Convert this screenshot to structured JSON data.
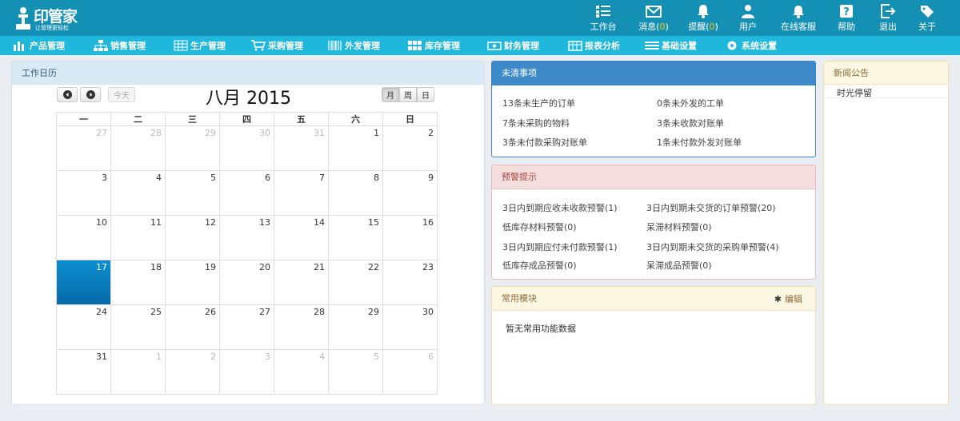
{
  "brand": {
    "name": "印管家",
    "slogan": "让管理更轻松"
  },
  "top_nav": [
    {
      "label": "工作台",
      "icon": "workbench-icon"
    },
    {
      "label": "消息",
      "count": "0",
      "icon": "envelope-icon"
    },
    {
      "label": "提醒",
      "count": "0",
      "icon": "bell-icon"
    },
    {
      "label": "用户",
      "icon": "user-icon"
    },
    {
      "label": "在线客服",
      "icon": "service-bell-icon"
    },
    {
      "label": "帮助",
      "icon": "help-icon"
    },
    {
      "label": "退出",
      "icon": "logout-icon"
    },
    {
      "label": "关于",
      "icon": "tag-icon"
    }
  ],
  "menu": [
    {
      "label": "产品管理",
      "icon": "bar-chart-icon"
    },
    {
      "label": "销售管理",
      "icon": "sitemap-icon"
    },
    {
      "label": "生产管理",
      "icon": "grid-icon"
    },
    {
      "label": "采购管理",
      "icon": "cart-icon"
    },
    {
      "label": "外发管理",
      "icon": "barcode-icon"
    },
    {
      "label": "库存管理",
      "icon": "blocks-icon"
    },
    {
      "label": "财务管理",
      "icon": "money-icon"
    },
    {
      "label": "报表分析",
      "icon": "calendar-table-icon"
    },
    {
      "label": "基础设置",
      "icon": "list-icon"
    },
    {
      "label": "系统设置",
      "icon": "gear-icon"
    }
  ],
  "calendar": {
    "panel_title": "工作日历",
    "title": "八月 2015",
    "today_label": "今天",
    "views": [
      "月",
      "周",
      "日"
    ],
    "active_view": "月",
    "weekdays": [
      "一",
      "二",
      "三",
      "四",
      "五",
      "六",
      "日"
    ],
    "today": "17",
    "weeks": [
      [
        {
          "d": "27",
          "o": 1
        },
        {
          "d": "28",
          "o": 1
        },
        {
          "d": "29",
          "o": 1
        },
        {
          "d": "30",
          "o": 1
        },
        {
          "d": "31",
          "o": 1
        },
        {
          "d": "1"
        },
        {
          "d": "2"
        }
      ],
      [
        {
          "d": "3"
        },
        {
          "d": "4"
        },
        {
          "d": "5"
        },
        {
          "d": "6"
        },
        {
          "d": "7"
        },
        {
          "d": "8"
        },
        {
          "d": "9"
        }
      ],
      [
        {
          "d": "10"
        },
        {
          "d": "11"
        },
        {
          "d": "12"
        },
        {
          "d": "13"
        },
        {
          "d": "14"
        },
        {
          "d": "15"
        },
        {
          "d": "16"
        }
      ],
      [
        {
          "d": "17",
          "t": 1
        },
        {
          "d": "18"
        },
        {
          "d": "19"
        },
        {
          "d": "20"
        },
        {
          "d": "21"
        },
        {
          "d": "22"
        },
        {
          "d": "23"
        }
      ],
      [
        {
          "d": "24"
        },
        {
          "d": "25"
        },
        {
          "d": "26"
        },
        {
          "d": "27"
        },
        {
          "d": "28"
        },
        {
          "d": "29"
        },
        {
          "d": "30"
        }
      ],
      [
        {
          "d": "31"
        },
        {
          "d": "1",
          "o": 1
        },
        {
          "d": "2",
          "o": 1
        },
        {
          "d": "3",
          "o": 1
        },
        {
          "d": "4",
          "o": 1
        },
        {
          "d": "5",
          "o": 1
        },
        {
          "d": "6",
          "o": 1
        }
      ]
    ]
  },
  "todo": {
    "title": "未清事项",
    "items": [
      "13条未生产的订单",
      "0条未外发的工单",
      "7条未采购的物料",
      "3条未收款对账单",
      "3条未付款采购对账单",
      "1条未付款外发对账单"
    ]
  },
  "warnings": {
    "title": "预警提示",
    "items": [
      "3日内到期应收未收款预警(1)",
      "3日内到期未交货的订单预警(20)",
      "低库存材料预警(0)",
      "呆滞材料预警(0)",
      "3日内到期应付未付款预警(1)",
      "3日内到期未交货的采购单预警(4)",
      "低库存成品预警(0)",
      "呆滞成品预警(0)"
    ]
  },
  "common_modules": {
    "title": "常用模块",
    "edit_label": "编辑",
    "empty_text": "暂无常用功能数据"
  },
  "news": {
    "title": "新闻公告",
    "items": [
      "时光停留"
    ]
  },
  "colors": {
    "topbar": "#1590b5",
    "menubar": "#20b7dc",
    "today_cell": "#0b7fc2",
    "todo_header": "#3e8ac9",
    "warn_header": "#f4dede",
    "notice_header": "#fcf7e3",
    "badge_count": "#f6c400"
  }
}
